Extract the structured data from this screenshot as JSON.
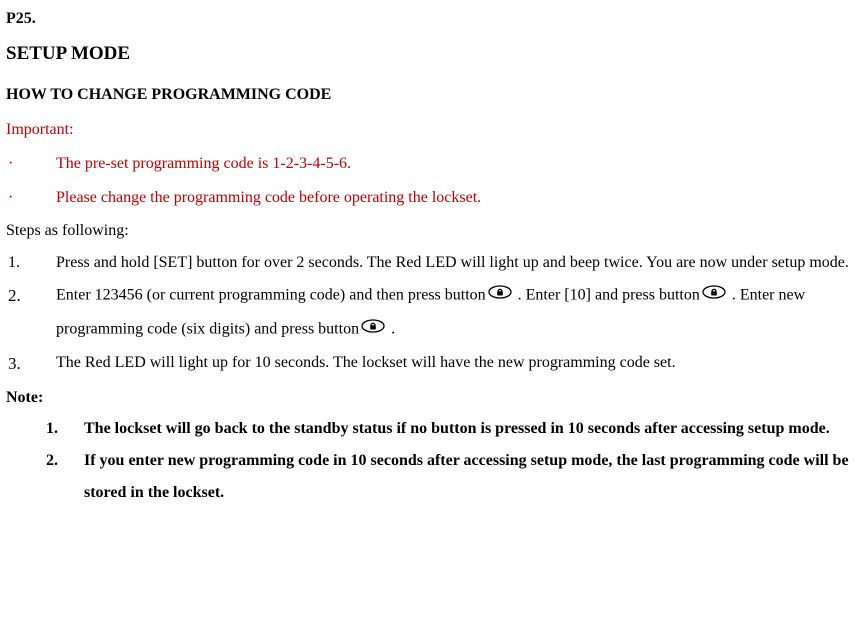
{
  "page_number": "P25.",
  "title": "SETUP MODE",
  "subtitle": "HOW TO CHANGE PROGRAMMING CODE",
  "important": {
    "label": "Important:",
    "bullets": [
      "The pre-set programming code is 1-2-3-4-5-6.",
      "Please change the programming code before operating the lockset."
    ]
  },
  "steps": {
    "label": "Steps as following:",
    "items": [
      {
        "marker": "1.",
        "text": "Press and hold [SET] button for over 2 seconds. The Red LED will light up and beep twice. You are now under setup mode."
      },
      {
        "marker": "2.",
        "parts": {
          "p1": "Enter 123456 (or current programming code) and then press button",
          "p2": " . Enter [10] and press button",
          "p3": " . Enter new programming code (six digits) and press button",
          "p4": " ."
        }
      },
      {
        "marker": "3.",
        "text": "The Red LED will light up for 10 seconds. The lockset will have the new programming code set."
      }
    ]
  },
  "note": {
    "label": "Note:",
    "items": [
      {
        "marker": "1.",
        "text": "The lockset will go back to the standby status if no button is pressed in 10 seconds after accessing setup mode."
      },
      {
        "marker": "2.",
        "text": "If you enter new programming code in 10 seconds after accessing setup mode, the last programming code will be stored in the lockset."
      }
    ]
  }
}
